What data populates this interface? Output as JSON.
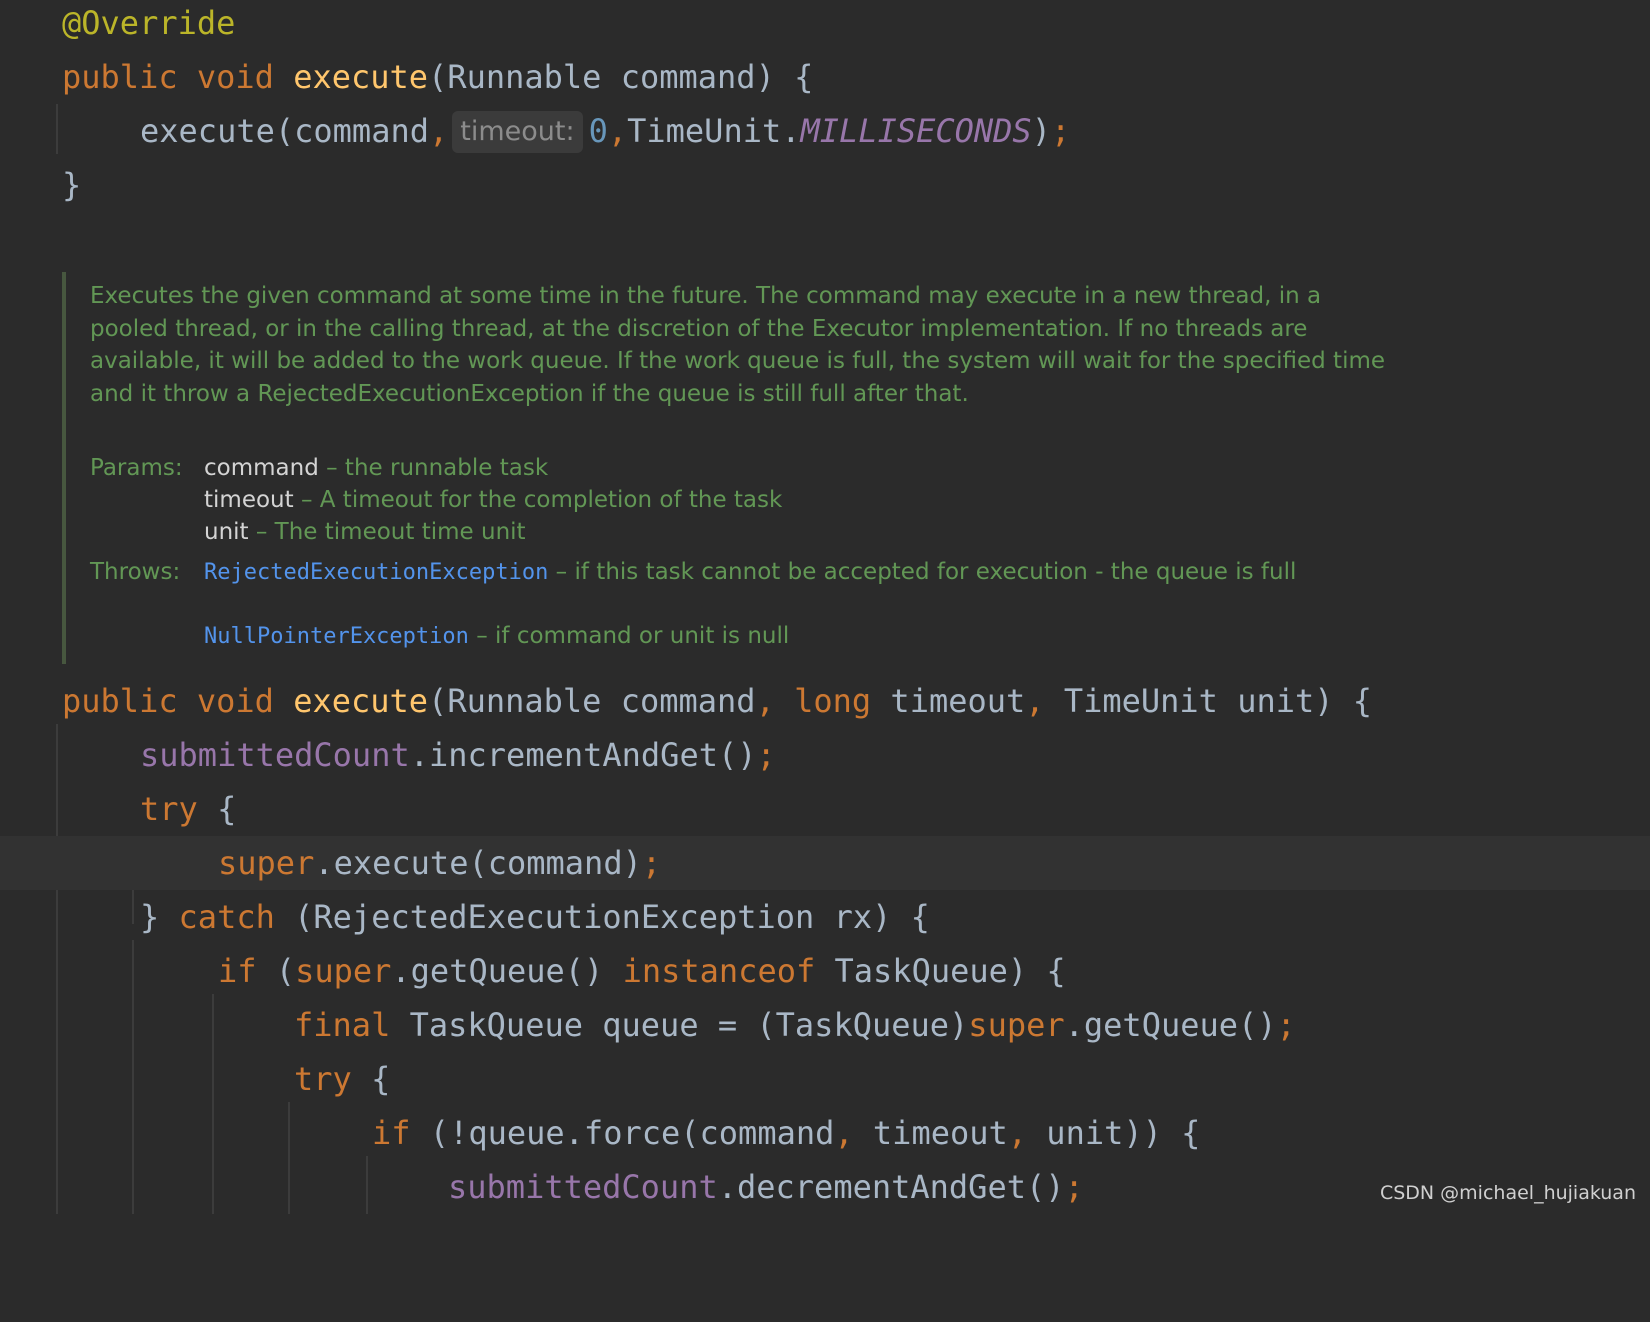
{
  "editor": {
    "code_top": [
      [
        {
          "t": "@Override",
          "c": "ann"
        }
      ],
      [
        {
          "t": "public",
          "c": "kw"
        },
        {
          "t": " "
        },
        {
          "t": "void",
          "c": "kw"
        },
        {
          "t": " "
        },
        {
          "t": "execute",
          "c": "fn"
        },
        {
          "t": "(Runnable command) {"
        }
      ],
      [
        {
          "t": "execute(command"
        },
        {
          "t": ",",
          "c": "kw"
        },
        {
          "hint": "timeout:"
        },
        {
          "t": "0",
          "c": "num"
        },
        {
          "t": ",",
          "c": "kw"
        },
        {
          "t": "TimeUnit."
        },
        {
          "t": "MILLISECONDS",
          "c": "cst"
        },
        {
          "t": ")"
        },
        {
          "t": ";",
          "c": "kw"
        }
      ],
      [
        {
          "t": "}"
        }
      ]
    ],
    "code_bottom": [
      [
        {
          "t": "public",
          "c": "kw"
        },
        {
          "t": " "
        },
        {
          "t": "void",
          "c": "kw"
        },
        {
          "t": " "
        },
        {
          "t": "execute",
          "c": "fn"
        },
        {
          "t": "(Runnable command"
        },
        {
          "t": ",",
          "c": "kw"
        },
        {
          "t": " "
        },
        {
          "t": "long",
          "c": "kw"
        },
        {
          "t": " timeout"
        },
        {
          "t": ",",
          "c": "kw"
        },
        {
          "t": " TimeUnit unit) {"
        }
      ],
      [
        {
          "t": "submittedCount",
          "c": "fld"
        },
        {
          "t": ".incrementAndGet()"
        },
        {
          "t": ";",
          "c": "kw"
        }
      ],
      [
        {
          "t": "try",
          "c": "kw"
        },
        {
          "t": " {"
        }
      ],
      [
        {
          "t": "super",
          "c": "kw"
        },
        {
          "t": ".execute(command)"
        },
        {
          "t": ";",
          "c": "kw"
        }
      ],
      [
        {
          "t": "} "
        },
        {
          "t": "catch",
          "c": "kw"
        },
        {
          "t": " (RejectedExecutionException rx) {"
        }
      ],
      [
        {
          "t": "if",
          "c": "kw"
        },
        {
          "t": " ("
        },
        {
          "t": "super",
          "c": "kw"
        },
        {
          "t": ".getQueue() "
        },
        {
          "t": "instanceof",
          "c": "kw"
        },
        {
          "t": " TaskQueue) {"
        }
      ],
      [
        {
          "t": "final",
          "c": "kw"
        },
        {
          "t": " TaskQueue queue = (TaskQueue)"
        },
        {
          "t": "super",
          "c": "kw"
        },
        {
          "t": ".getQueue()"
        },
        {
          "t": ";",
          "c": "kw"
        }
      ],
      [
        {
          "t": "try",
          "c": "kw"
        },
        {
          "t": " {"
        }
      ],
      [
        {
          "t": "if",
          "c": "kw"
        },
        {
          "t": " (!queue.force(command"
        },
        {
          "t": ",",
          "c": "kw"
        },
        {
          "t": " timeout"
        },
        {
          "t": ",",
          "c": "kw"
        },
        {
          "t": " unit)) {"
        }
      ],
      [
        {
          "t": "submittedCount",
          "c": "fld"
        },
        {
          "t": ".decrementAndGet()"
        },
        {
          "t": ";",
          "c": "kw"
        }
      ]
    ]
  },
  "javadoc": {
    "description": "Executes the given command at some time in the future. The command may execute in a new thread, in a pooled thread, or in the calling thread, at the discretion of the Executor implementation. If no threads are available, it will be added to the work queue. If the work queue is full, the system will wait for the specified time and it throw a RejectedExecutionException if the queue is still full after that.",
    "params_label": "Params:",
    "params": [
      {
        "name": "command",
        "desc": " – the runnable task"
      },
      {
        "name": "timeout",
        "desc": " – A timeout for the completion of the task"
      },
      {
        "name": "unit",
        "desc": " – The timeout time unit"
      }
    ],
    "throws_label": "Throws:",
    "throws": [
      {
        "name": "RejectedExecutionException",
        "desc": " – if this task cannot be accepted for execution - the queue is full"
      },
      {
        "name": "NullPointerException",
        "desc": " – if command or unit is null"
      }
    ]
  },
  "watermark": "CSDN @michael_hujiakuan"
}
